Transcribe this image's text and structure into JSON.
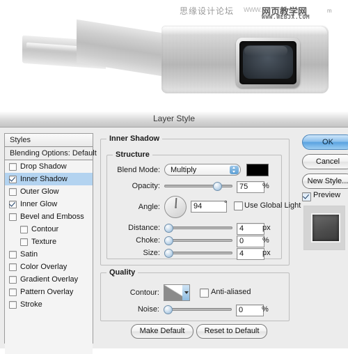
{
  "watermark": {
    "chinese": "思缘设计论坛",
    "www_small": "WWW.",
    "brand": "网页教学网",
    "trailing": "m",
    "url": "WWW.WEBJX.COM"
  },
  "photo": {
    "alt_name": "metallic-device-with-dark-screen"
  },
  "dialog": {
    "title": "Layer Style"
  },
  "styles_panel": {
    "header": "Styles",
    "blending_options": "Blending Options: Default",
    "effects": [
      {
        "label": "Drop Shadow",
        "checked": false,
        "selected": false,
        "indent": false
      },
      {
        "label": "Inner Shadow",
        "checked": true,
        "selected": true,
        "indent": false
      },
      {
        "label": "Outer Glow",
        "checked": false,
        "selected": false,
        "indent": false
      },
      {
        "label": "Inner Glow",
        "checked": true,
        "selected": false,
        "indent": false
      },
      {
        "label": "Bevel and Emboss",
        "checked": false,
        "selected": false,
        "indent": false
      },
      {
        "label": "Contour",
        "checked": false,
        "selected": false,
        "indent": true
      },
      {
        "label": "Texture",
        "checked": false,
        "selected": false,
        "indent": true
      },
      {
        "label": "Satin",
        "checked": false,
        "selected": false,
        "indent": false
      },
      {
        "label": "Color Overlay",
        "checked": false,
        "selected": false,
        "indent": false
      },
      {
        "label": "Gradient Overlay",
        "checked": false,
        "selected": false,
        "indent": false
      },
      {
        "label": "Pattern Overlay",
        "checked": false,
        "selected": false,
        "indent": false
      },
      {
        "label": "Stroke",
        "checked": false,
        "selected": false,
        "indent": false
      }
    ]
  },
  "inner_shadow": {
    "group_label": "Inner Shadow",
    "structure": {
      "legend": "Structure",
      "blend_mode_label": "Blend Mode:",
      "blend_mode_value": "Multiply",
      "blend_color": "#000000",
      "opacity_label": "Opacity:",
      "opacity_value": "75",
      "opacity_unit": "%",
      "angle_label": "Angle:",
      "angle_value": "94",
      "angle_unit": "°",
      "use_global_light_label": "Use Global Light",
      "use_global_light_checked": false,
      "distance_label": "Distance:",
      "distance_value": "4",
      "distance_unit": "px",
      "choke_label": "Choke:",
      "choke_value": "0",
      "choke_unit": "%",
      "size_label": "Size:",
      "size_value": "4",
      "size_unit": "px"
    },
    "quality": {
      "legend": "Quality",
      "contour_label": "Contour:",
      "anti_aliased_label": "Anti-aliased",
      "anti_aliased_checked": false,
      "noise_label": "Noise:",
      "noise_value": "0",
      "noise_unit": "%"
    },
    "make_default": "Make Default",
    "reset_to_default": "Reset to Default"
  },
  "actions": {
    "ok": "OK",
    "cancel": "Cancel",
    "new_style": "New Style...",
    "preview_label": "Preview",
    "preview_checked": true
  },
  "colors": {
    "selection_blue": "#b3d3f0",
    "dialog_bg": "#ececec",
    "accent": "#5aa3e0"
  }
}
